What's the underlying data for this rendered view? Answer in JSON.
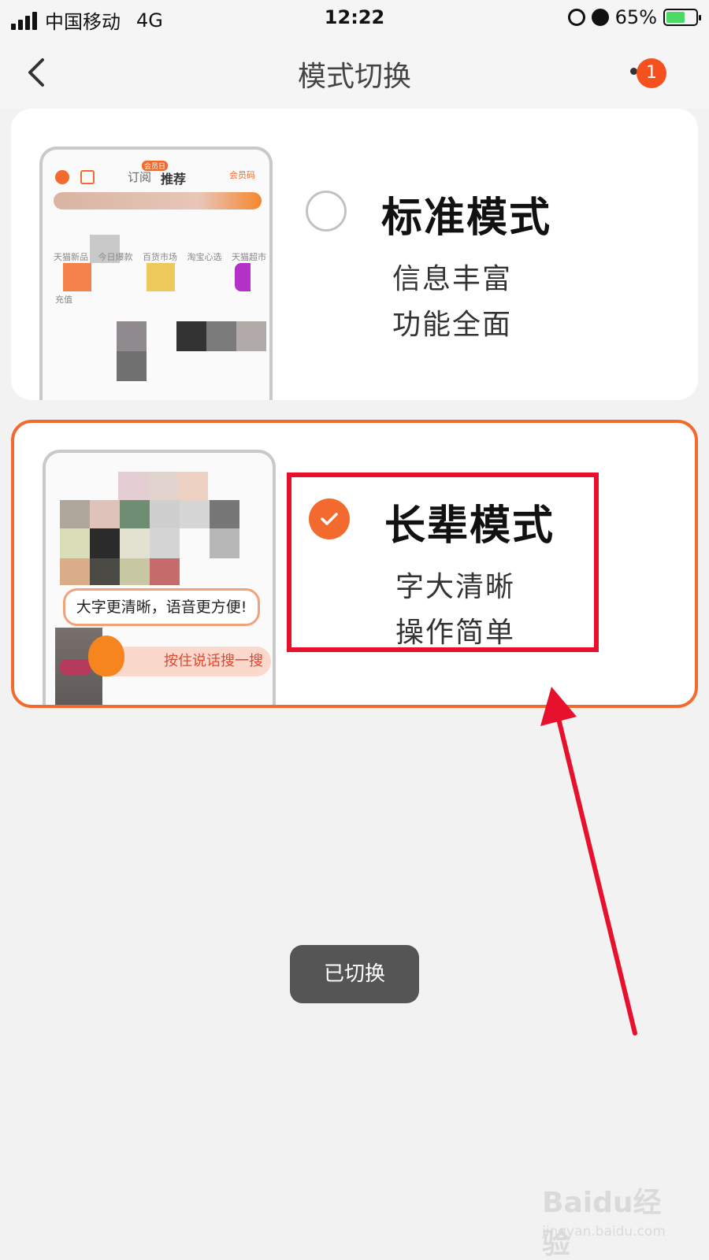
{
  "status_bar": {
    "carrier": "中国移动",
    "network": "4G",
    "time": "12:22",
    "battery_percent": "65%",
    "battery_level": 0.65
  },
  "nav": {
    "title": "模式切换",
    "badge_count": "1",
    "icons": [
      "back-chevron-icon",
      "more-dots-icon"
    ]
  },
  "modes": {
    "standard": {
      "title": "标准模式",
      "desc_line1": "信息丰富",
      "desc_line2": "功能全面",
      "selected": false,
      "preview": {
        "tab_subscribe": "订阅",
        "tab_recommend": "推荐",
        "tab_badge": "会员日",
        "vip_code": "会员码",
        "categories": [
          "天猫新品",
          "今日爆款",
          "百货市场",
          "淘宝心选",
          "天猫超市"
        ],
        "charge": "充值"
      }
    },
    "elder": {
      "title": "长辈模式",
      "desc_line1": "字大清晰",
      "desc_line2": "操作简单",
      "selected": true,
      "preview": {
        "bubble_text": "大字更清晰，语音更方便!",
        "voice_button": "按住说话搜一搜"
      }
    }
  },
  "toast": {
    "message": "已切换"
  },
  "watermark": {
    "brand": "Baidu经验",
    "url": "jingyan.baidu.com"
  },
  "colors": {
    "accent": "#f26a2e",
    "annotation_red": "#e8112d",
    "background": "#f2f2f2"
  }
}
